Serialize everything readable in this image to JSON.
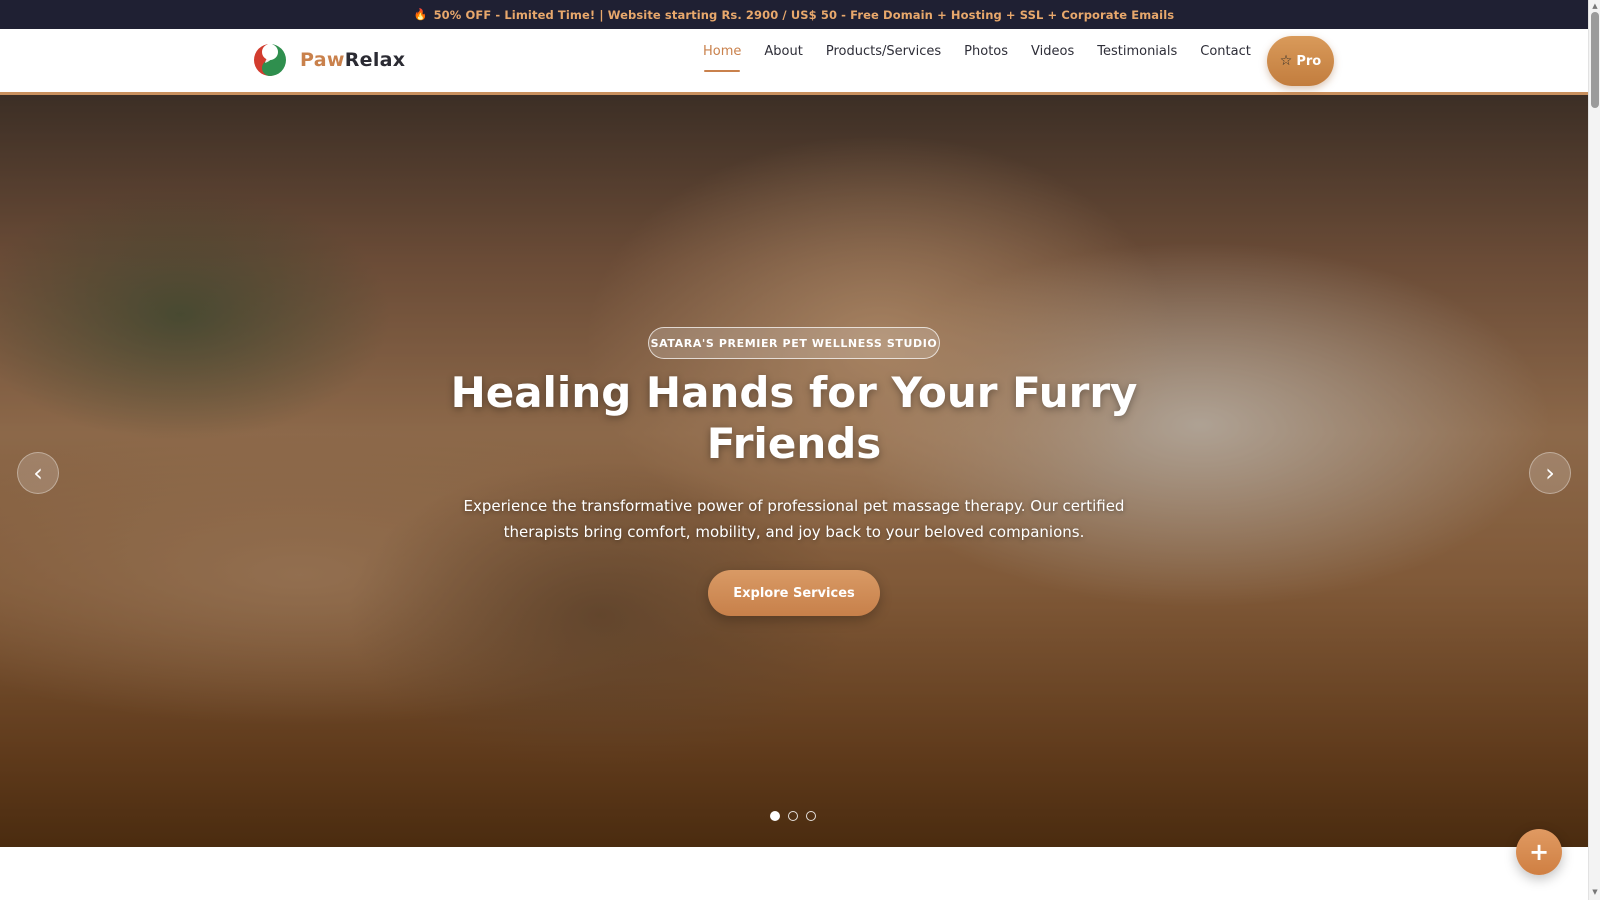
{
  "promo": {
    "icon": "fire-icon",
    "text": "50% OFF - Limited Time! | Website starting Rs. 2900 / US$ 50 - Free Domain + Hosting + SSL + Corporate Emails"
  },
  "header": {
    "logo_icon": "yin-yang-leaf-logo",
    "brand_part1": "Paw",
    "brand_part2": "Relax",
    "nav": [
      {
        "label": "Home",
        "active": true
      },
      {
        "label": "About"
      },
      {
        "label": "Products/Services"
      },
      {
        "label": "Photos"
      },
      {
        "label": "Videos"
      },
      {
        "label": "Testimonials"
      },
      {
        "label": "Contact"
      }
    ],
    "pro_icon": "star-icon",
    "pro_label": "Pro"
  },
  "hero": {
    "badge": "SATARA'S PREMIER PET WELLNESS STUDIO",
    "title": "Healing Hands for Your Furry Friends",
    "subtitle": "Experience the transformative power of professional pet massage therapy. Our certified therapists bring comfort, mobility, and joy back to your beloved companions.",
    "cta": "Explore Services",
    "prev_icon": "‹",
    "next_icon": "›",
    "slide_count": 3,
    "active_slide": 1
  },
  "fab": {
    "icon": "+"
  },
  "colors": {
    "accent": "#c9814c",
    "promo_bg": "#1f2033",
    "promo_text": "#e8a86c"
  }
}
